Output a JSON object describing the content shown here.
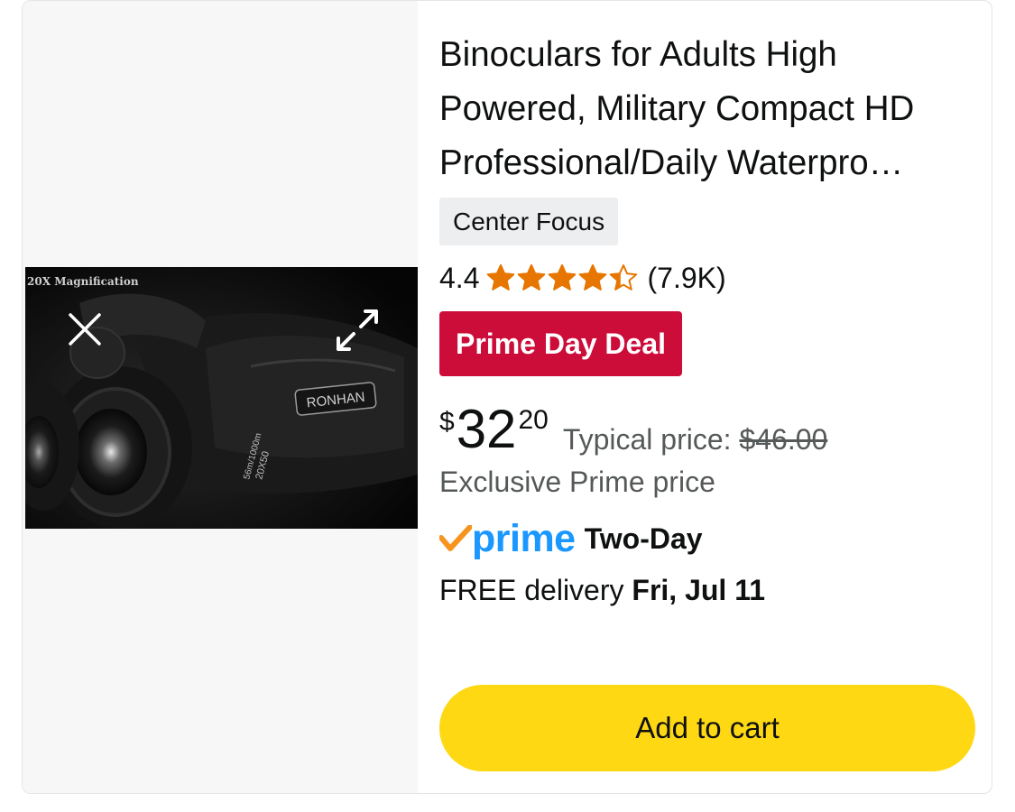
{
  "product": {
    "title_lines": [
      "Binoculars for Adults High",
      "Powered, Military Compact HD",
      "Professional/Daily Waterpro…"
    ],
    "variant": "Center Focus",
    "rating": "4.4",
    "rating_value": 4.4,
    "rating_max": 5,
    "rating_count": "(7.9K)",
    "deal_badge": "Prime Day Deal",
    "price": {
      "symbol": "$",
      "whole": "32",
      "fraction": "20",
      "typical_label": "Typical price:",
      "typical_value": "$46.00"
    },
    "exclusive_note": "Exclusive Prime price",
    "prime": {
      "logo_text": "prime",
      "speed": "Two-Day"
    },
    "delivery": {
      "prefix": "FREE delivery",
      "date": "Fri, Jul 11"
    },
    "add_to_cart": "Add to cart"
  },
  "media": {
    "overlay_text": "20X Magnification",
    "brand_text": "RONHAN",
    "spec_text_1": "20X50",
    "spec_text_2": "56m/1000m",
    "close_icon": "close-icon",
    "expand_icon": "expand-icon"
  },
  "colors": {
    "star": "#e77600",
    "deal_red": "#cc0c39",
    "prime_blue": "#1a98ff",
    "prime_check": "#f7941d",
    "cart_yellow": "#ffd814",
    "muted_text": "#565959"
  }
}
